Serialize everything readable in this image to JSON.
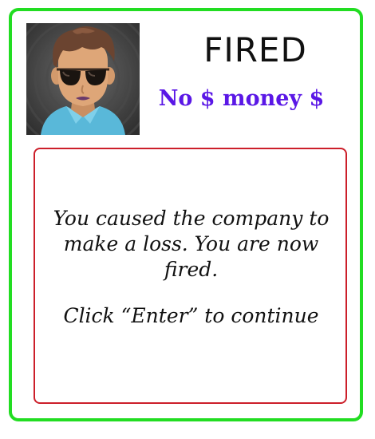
{
  "card": {
    "title": "FIRED",
    "money_status": "No $ money $",
    "avatar_icon": "character-portrait",
    "message": "You caused the company to make a loss. You are now fired.",
    "prompt": "Click “Enter” to continue"
  },
  "colors": {
    "card_border": "#22dd22",
    "message_border": "#cc1f2a",
    "money_text": "#5a17e6"
  }
}
